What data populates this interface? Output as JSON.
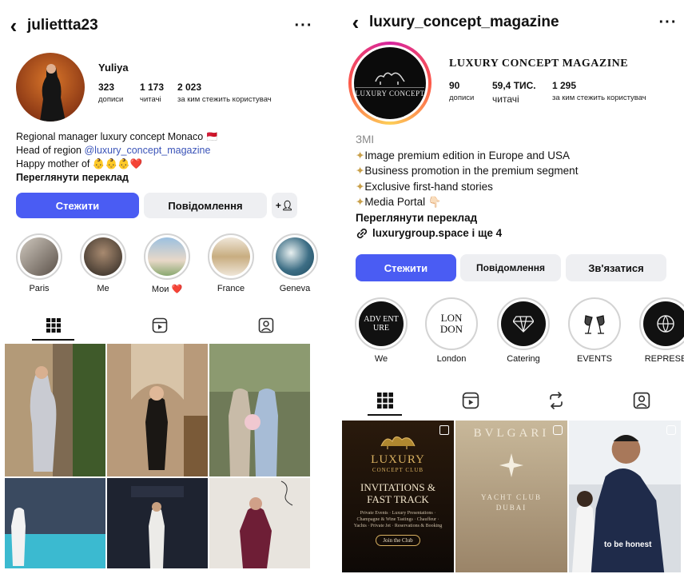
{
  "left": {
    "username": "juliettta23",
    "display_name": "Yuliya",
    "stats": [
      {
        "value": "323",
        "label": "дописи"
      },
      {
        "value": "1 173",
        "label": "читачі"
      },
      {
        "value": "2 023",
        "label": "за ким стежить користувач"
      }
    ],
    "bio": {
      "line1": "Regional manager luxury concept Monaco 🇲🇨",
      "line2_prefix": "Head of region ",
      "line2_link": "@luxury_concept_magazine",
      "line3": "Happy mother of 👶👶👶❤️",
      "translate": "Переглянути переклад"
    },
    "buttons": {
      "follow": "Стежити",
      "message": "Повідомлення"
    },
    "highlights": [
      {
        "label": "Paris"
      },
      {
        "label": "Me"
      },
      {
        "label": "Мои ❤️"
      },
      {
        "label": "France"
      },
      {
        "label": "Geneva"
      }
    ]
  },
  "right": {
    "username": "luxury_concept_magazine",
    "display_name": "LUXURY CONCEPT MAGAZINE",
    "avatar_text": "LUXURY CONCEPT",
    "stats": [
      {
        "value": "90",
        "label": "дописи"
      },
      {
        "value": "59,4 ТИС.",
        "label": "читачі"
      },
      {
        "value": "1 295",
        "label": "за ким стежить користувач"
      }
    ],
    "bio": {
      "category": "ЗМІ",
      "lines": [
        "Image premium edition in Europe and USA",
        "Business promotion in the premium segment",
        "Exclusive first-hand stories",
        "Media Portal 👇🏻"
      ],
      "translate": "Переглянути переклад",
      "link": "luxurygroup.space і ще 4"
    },
    "buttons": {
      "follow": "Стежити",
      "message": "Повідомлення",
      "contact": "Зв'язатися"
    },
    "highlights": [
      {
        "label": "We",
        "text": "ADV ENT URE"
      },
      {
        "label": "London",
        "text": "LON DON"
      },
      {
        "label": "Catering",
        "text": ""
      },
      {
        "label": "EVENTS",
        "text": ""
      },
      {
        "label": "REPRESE",
        "text": ""
      }
    ],
    "posts": {
      "post1_brand": "LUXURY",
      "post1_sub": "CONCEPT CLUB",
      "post1_title": "INVITATIONS & FAST TRACK",
      "post1_body": "Private Events · Luxury Presentations · Champagne & Wine Tastings · Chauffeur · Yachts · Private Jet · Reservations & Booking",
      "post1_btn": "Join the Club",
      "post2_brand": "BVLGARI",
      "post2_sub": "YACHT CLUB DUBAI",
      "post3_caption": "to be honest"
    }
  },
  "colors": {
    "primary": "#4a5cf3",
    "secondary": "#eeeff2",
    "link": "#3a53b8"
  }
}
